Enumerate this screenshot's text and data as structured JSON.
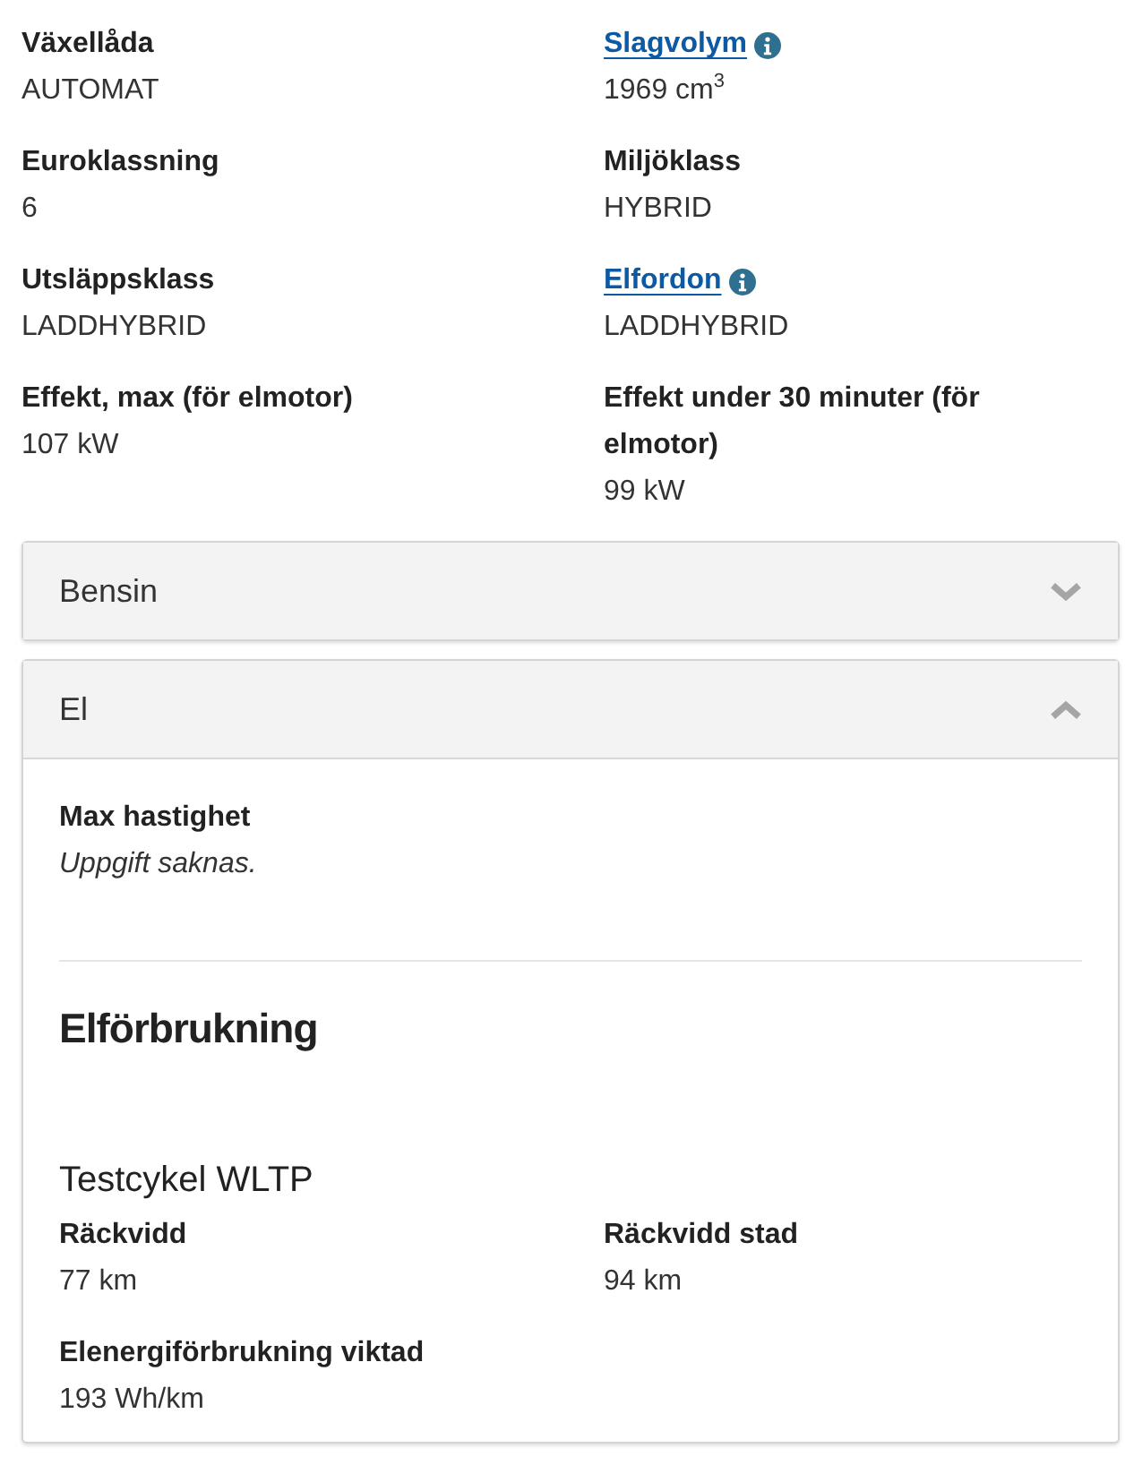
{
  "specs": [
    {
      "label": "Växellåda",
      "value": "AUTOMAT",
      "link": false,
      "info": false
    },
    {
      "label": "Slagvolym",
      "value": "1969 cm$^{3}$",
      "link": true,
      "info": true
    },
    {
      "label": "Euroklassning",
      "value": "6",
      "link": false,
      "info": false
    },
    {
      "label": "Miljöklass",
      "value": "HYBRID",
      "link": false,
      "info": false
    },
    {
      "label": "Utsläppsklass",
      "value": "LADDHYBRID",
      "link": false,
      "info": false
    },
    {
      "label": "Elfordon",
      "value": "LADDHYBRID",
      "link": true,
      "info": true
    },
    {
      "label": "Effekt, max (för elmotor)",
      "value": "107 kW",
      "link": false,
      "info": false
    },
    {
      "label": "Effekt under 30 minuter (för elmotor)",
      "value": "99 kW",
      "link": false,
      "info": false
    }
  ],
  "sections": [
    {
      "title": "Bensin",
      "expanded": false
    },
    {
      "title": "El",
      "expanded": true,
      "content": {
        "top_fields": [
          {
            "label": "Max hastighet",
            "value": "Uppgift saknas.",
            "kind": "missing"
          }
        ],
        "heading": "Elförbrukning",
        "subheading": "Testcykel WLTP",
        "fields": [
          {
            "label": "Räckvidd",
            "value": "77 km"
          },
          {
            "label": "Räckvidd stad",
            "value": "94 km"
          },
          {
            "label": "Elenergiförbrukning viktad",
            "value": "193 Wh/km"
          }
        ]
      }
    }
  ]
}
